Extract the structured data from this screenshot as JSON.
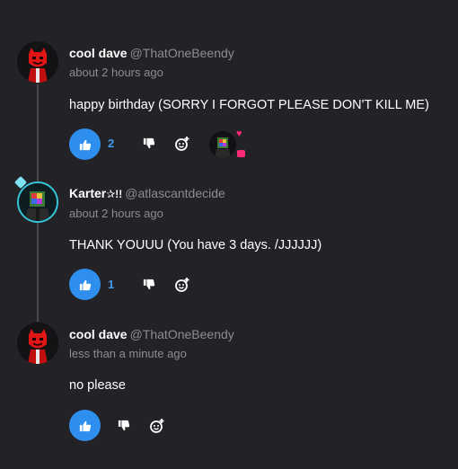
{
  "comments": [
    {
      "username": "cool dave",
      "handle": "@ThatOneBeendy",
      "time": "about 2 hours ago",
      "text": "happy birthday (SORRY I FORGOT PLEASE DON'T KILL ME)",
      "likes": "2",
      "avatar_icon": "red-devil-avatar"
    },
    {
      "username": "Karter",
      "username_suffix": "✰!!",
      "handle": "@atlascantdecide",
      "time": "about 2 hours ago",
      "text": "THANK YOUUU (You have 3 days. /JJJJJJ)",
      "likes": "1",
      "avatar_icon": "rainbow-cube-avatar"
    },
    {
      "username": "cool dave",
      "handle": "@ThatOneBeendy",
      "time": "less than a minute ago",
      "text": "no please",
      "likes": "",
      "avatar_icon": "red-devil-avatar"
    }
  ],
  "colors": {
    "background": "#232227",
    "like_button": "#2e8fee",
    "like_count": "#3f9bef",
    "muted_text": "#8d8c92",
    "reaction_accent": "#ff2a73",
    "avatar_ring": "#35c3d6"
  },
  "icons": {
    "like": "thumbs-up-icon",
    "dislike": "thumbs-down-icon",
    "react": "add-reaction-icon",
    "reaction_heart": "heart-icon"
  }
}
